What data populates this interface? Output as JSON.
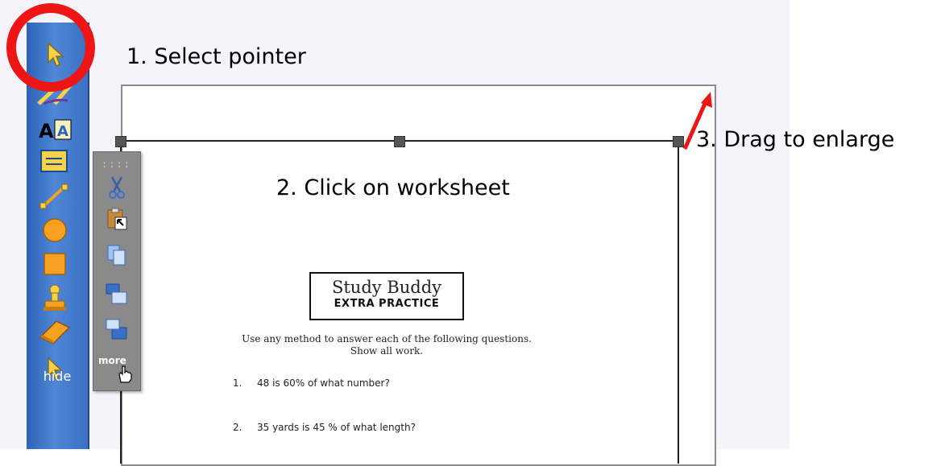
{
  "annotations": {
    "step1": "1.  Select pointer",
    "step2": "2.  Click on worksheet",
    "step3": "3.  Drag to enlarge"
  },
  "palette": {
    "tools": [
      "pointer-icon",
      "pen-icon",
      "text-icon",
      "shape-icon",
      "line-icon",
      "circle-icon",
      "square-icon",
      "stamp-icon",
      "eraser-icon",
      "select-arrow-icon"
    ],
    "hide_label": "hide"
  },
  "mini_toolbar": {
    "grip": "::::",
    "tools": [
      "cut-icon",
      "paste-icon",
      "copy-icon",
      "bring-forward-icon",
      "send-backward-icon"
    ],
    "more_label": "more"
  },
  "worksheet": {
    "title": "Study Buddy",
    "subtitle": "Extra Practice",
    "instructions_line1": "Use any method to answer each of the following questions.",
    "instructions_line2": "Show all work.",
    "questions": [
      {
        "num": "1.",
        "text": "48 is 60% of what number?"
      },
      {
        "num": "2.",
        "text": "35 yards is 45 % of what length?"
      }
    ]
  },
  "colors": {
    "highlight_circle": "#ee1515",
    "arrow": "#ee1515",
    "palette": "#3a6fc4"
  }
}
